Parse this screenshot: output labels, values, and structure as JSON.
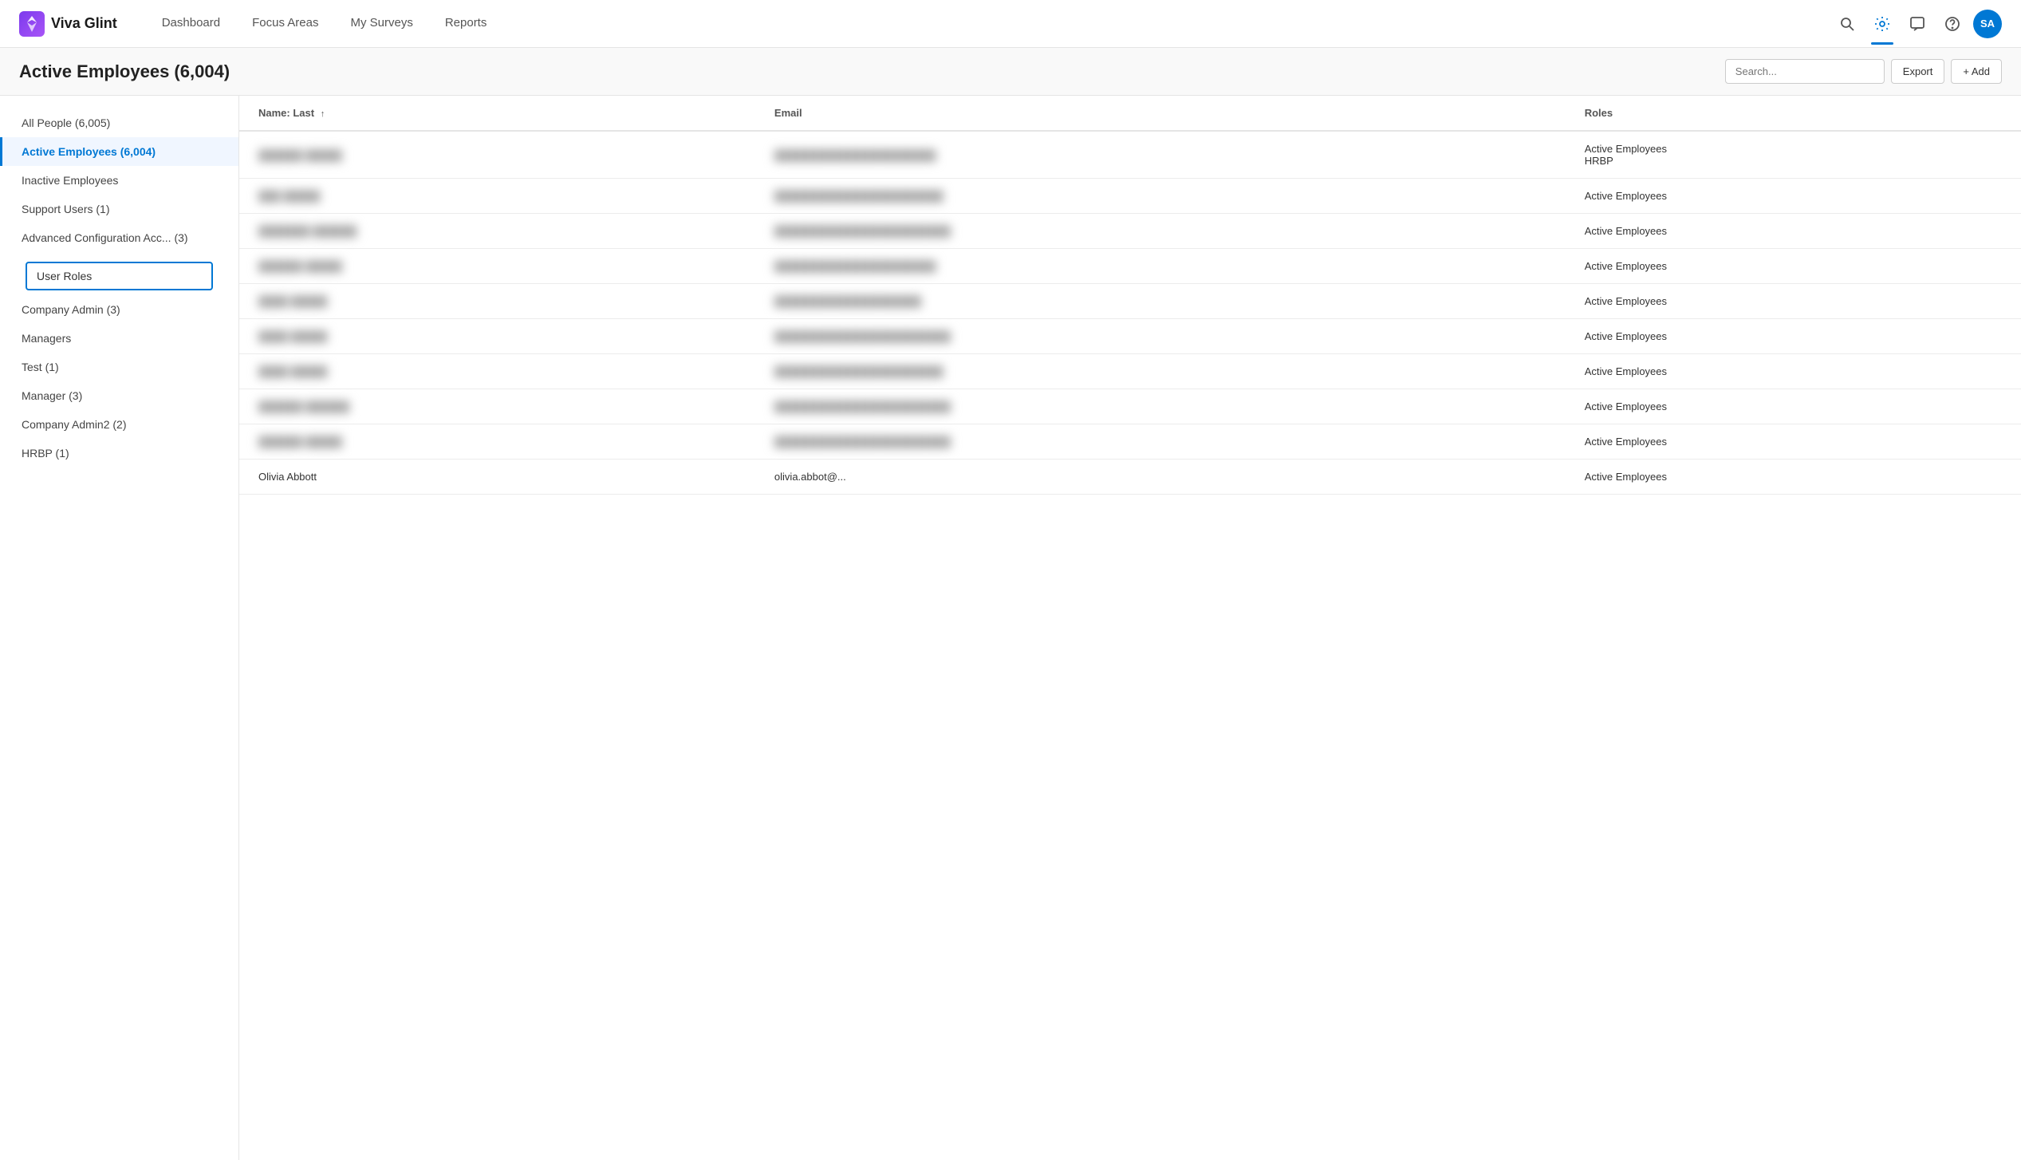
{
  "app": {
    "logo_text": "Viva Glint",
    "avatar_initials": "SA"
  },
  "nav": {
    "links": [
      {
        "id": "dashboard",
        "label": "Dashboard",
        "active": false
      },
      {
        "id": "focus-areas",
        "label": "Focus Areas",
        "active": false
      },
      {
        "id": "my-surveys",
        "label": "My Surveys",
        "active": false
      },
      {
        "id": "reports",
        "label": "Reports",
        "active": false
      }
    ]
  },
  "page": {
    "title": "Active Employees (6,004)",
    "search_placeholder": "Search..."
  },
  "sidebar": {
    "items": [
      {
        "id": "all-people",
        "label": "All People  (6,005)",
        "active": false
      },
      {
        "id": "active-employees",
        "label": "Active Employees  (6,004)",
        "active": true
      },
      {
        "id": "inactive-employees",
        "label": "Inactive Employees",
        "active": false
      },
      {
        "id": "support-users",
        "label": "Support Users  (1)",
        "active": false
      },
      {
        "id": "advanced-config",
        "label": "Advanced Configuration Acc...  (3)",
        "active": false
      }
    ],
    "user_roles_label": "User Roles",
    "role_items": [
      {
        "id": "company-admin",
        "label": "Company Admin  (3)"
      },
      {
        "id": "managers",
        "label": "Managers"
      },
      {
        "id": "test",
        "label": "Test  (1)"
      },
      {
        "id": "manager",
        "label": "Manager  (3)"
      },
      {
        "id": "company-admin2",
        "label": "Company Admin2  (2)"
      },
      {
        "id": "hrbp",
        "label": "HRBP  (1)"
      }
    ]
  },
  "table": {
    "columns": [
      {
        "id": "name",
        "label": "Name: Last",
        "sortable": true,
        "sort_icon": "↑"
      },
      {
        "id": "email",
        "label": "Email",
        "sortable": false
      },
      {
        "id": "roles",
        "label": "Roles",
        "sortable": false
      }
    ],
    "rows": [
      {
        "name": "██████ █████",
        "email": "██████████████████████",
        "roles": "Active Employees\nHRBP"
      },
      {
        "name": "███ █████",
        "email": "███████████████████████",
        "roles": "Active Employees"
      },
      {
        "name": "███████ ██████",
        "email": "████████████████████████",
        "roles": "Active Employees"
      },
      {
        "name": "██████ █████",
        "email": "██████████████████████",
        "roles": "Active Employees"
      },
      {
        "name": "████ █████",
        "email": "████████████████████",
        "roles": "Active Employees"
      },
      {
        "name": "████ █████",
        "email": "████████████████████████",
        "roles": "Active Employees"
      },
      {
        "name": "████ █████",
        "email": "███████████████████████",
        "roles": "Active Employees"
      },
      {
        "name": "██████ ██████",
        "email": "████████████████████████",
        "roles": "Active Employees"
      },
      {
        "name": "██████ █████",
        "email": "████████████████████████",
        "roles": "Active Employees"
      },
      {
        "name": "Olivia Abbott",
        "email": "olivia.abbot@...",
        "roles": "Active Employees"
      }
    ]
  }
}
